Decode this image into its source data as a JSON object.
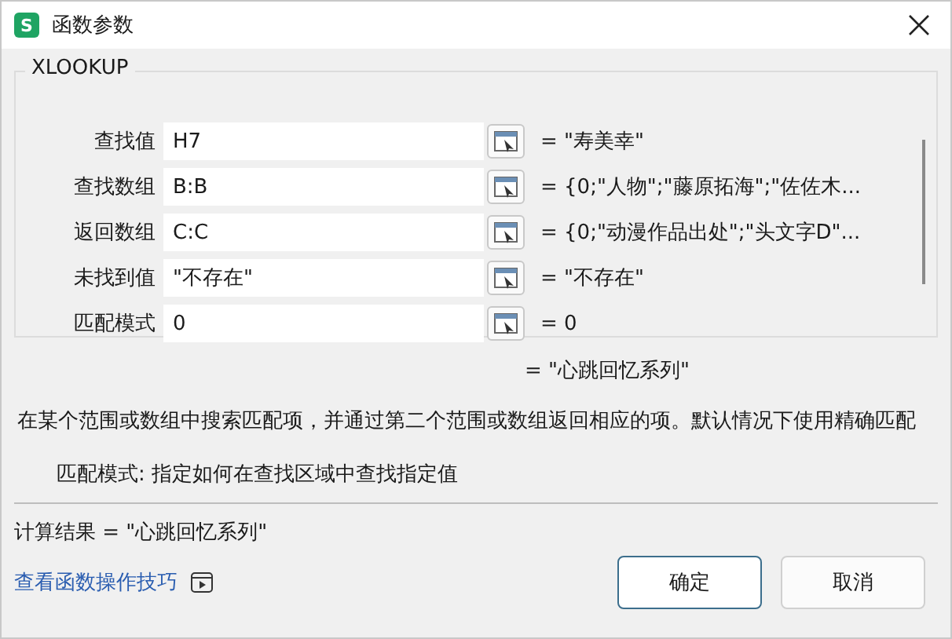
{
  "window": {
    "title": "函数参数",
    "app_icon": "S"
  },
  "function_name": "XLOOKUP",
  "arguments": [
    {
      "label": "查找值",
      "value": "H7",
      "result": "= \"寿美幸\""
    },
    {
      "label": "查找数组",
      "value": "B:B",
      "result": "= {0;\"人物\";\"藤原拓海\";\"佐佐木..."
    },
    {
      "label": "返回数组",
      "value": "C:C",
      "result": "= {0;\"动漫作品出处\";\"头文字D\"..."
    },
    {
      "label": "未找到值",
      "value": "\"不存在\"",
      "result": "= \"不存在\""
    },
    {
      "label": "匹配模式",
      "value": "0",
      "result": "= 0"
    }
  ],
  "formula_result": "= \"心跳回忆系列\"",
  "description": "在某个范围或数组中搜索匹配项，并通过第二个范围或数组返回相应的项。默认情况下使用精确匹配",
  "argument_help": "匹配模式:  指定如何在查找区域中查找指定值",
  "calc_result": "计算结果 = \"心跳回忆系列\"",
  "help_link": "查看函数操作技巧",
  "buttons": [
    {
      "label": "确定",
      "kind": "primary"
    },
    {
      "label": "取消",
      "kind": "secondary"
    }
  ]
}
